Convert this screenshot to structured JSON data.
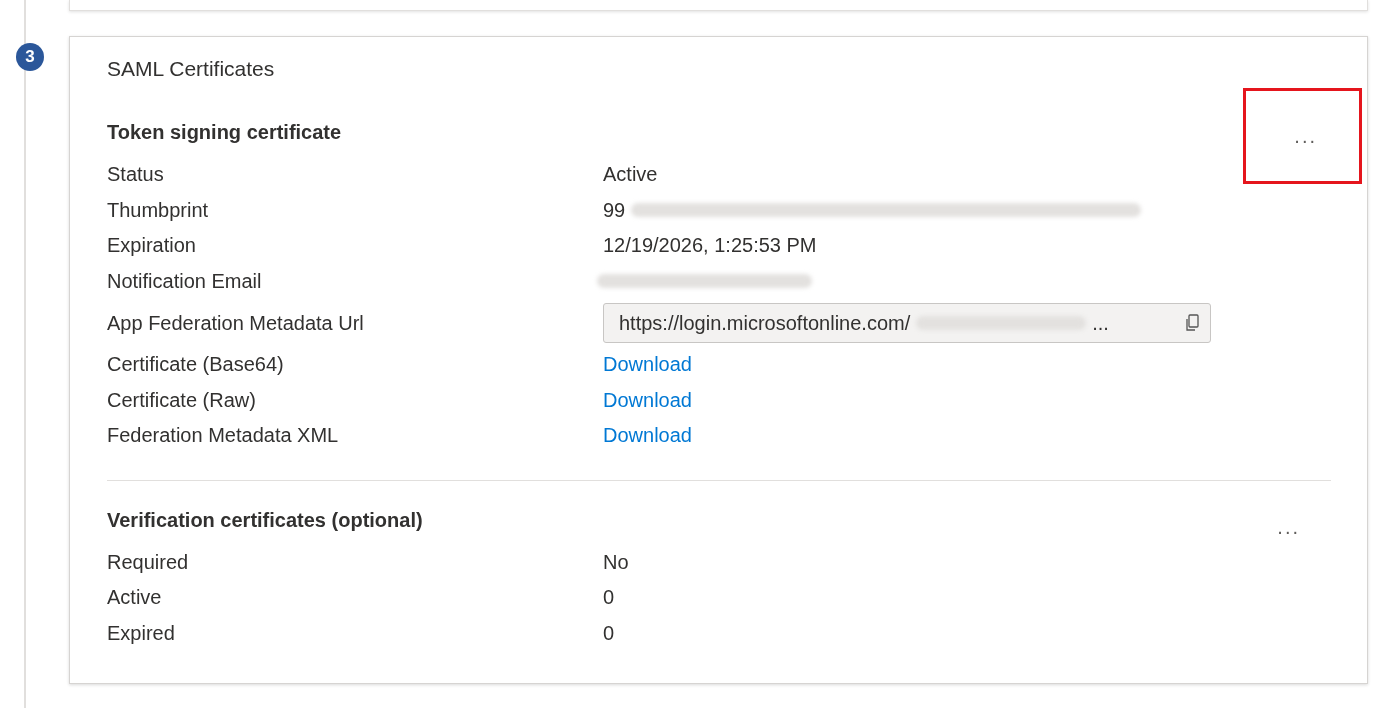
{
  "step": {
    "number": "3"
  },
  "card": {
    "title": "SAML Certificates",
    "sections": [
      {
        "title": "Token signing certificate",
        "more": {
          "label": "...",
          "highlighted": true
        },
        "rows": [
          {
            "label": "Status",
            "kind": "text",
            "value": "Active"
          },
          {
            "label": "Thumbprint",
            "kind": "text",
            "value": "99",
            "redacted": true
          },
          {
            "label": "Expiration",
            "kind": "text",
            "value": "12/19/2026, 1:25:53 PM"
          },
          {
            "label": "Notification Email",
            "kind": "text",
            "redacted": true
          },
          {
            "label": "App Federation Metadata Url",
            "kind": "field",
            "value": "https://login.microsoftonline.com/",
            "redacted": true,
            "suffix": "..."
          },
          {
            "label": "Certificate (Base64)",
            "kind": "link",
            "value": "Download"
          },
          {
            "label": "Certificate (Raw)",
            "kind": "link",
            "value": "Download"
          },
          {
            "label": "Federation Metadata XML",
            "kind": "link",
            "value": "Download"
          }
        ]
      },
      {
        "title": "Verification certificates (optional)",
        "more": {
          "label": "...",
          "highlighted": false
        },
        "rows": [
          {
            "label": "Required",
            "kind": "text",
            "value": "No"
          },
          {
            "label": "Active",
            "kind": "text",
            "value": "0"
          },
          {
            "label": "Expired",
            "kind": "text",
            "value": "0"
          }
        ]
      }
    ]
  }
}
